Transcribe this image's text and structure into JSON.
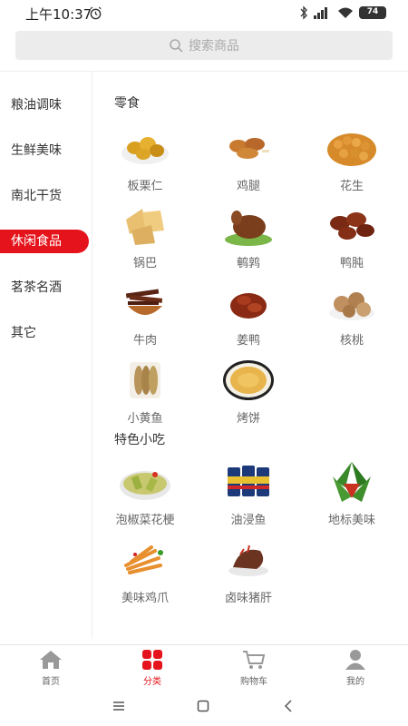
{
  "status_bar": {
    "time": "上午10:37",
    "battery": "74",
    "icons": [
      "alarm-icon",
      "bluetooth-icon",
      "signal-icon",
      "wifi-icon",
      "battery-icon"
    ]
  },
  "search": {
    "placeholder": "搜索商品",
    "icon": "search-icon"
  },
  "sidebar": {
    "items": [
      {
        "label": "粮油调味",
        "active": false
      },
      {
        "label": "生鲜美味",
        "active": false
      },
      {
        "label": "南北干货",
        "active": false
      },
      {
        "label": "休闲食品",
        "active": true
      },
      {
        "label": "茗茶名酒",
        "active": false
      },
      {
        "label": "其它",
        "active": false
      }
    ]
  },
  "sections": [
    {
      "title": "零食",
      "products": [
        {
          "name": "板栗仁",
          "icon": "chestnut-icon"
        },
        {
          "name": "鸡腿",
          "icon": "drumstick-icon"
        },
        {
          "name": "花生",
          "icon": "peanut-icon"
        },
        {
          "name": "锅巴",
          "icon": "rice-crisp-icon"
        },
        {
          "name": "鹌鹑",
          "icon": "quail-icon"
        },
        {
          "name": "鸭肫",
          "icon": "duck-gizzard-icon"
        },
        {
          "name": "牛肉",
          "icon": "beef-jerky-icon"
        },
        {
          "name": "姜鸭",
          "icon": "ginger-duck-icon"
        },
        {
          "name": "核桃",
          "icon": "walnut-icon"
        },
        {
          "name": "小黄鱼",
          "icon": "small-fish-icon"
        },
        {
          "name": "烤饼",
          "icon": "baked-cake-icon"
        }
      ]
    },
    {
      "title": "特色小吃",
      "products": [
        {
          "name": "泡椒菜花梗",
          "icon": "pickled-vegetable-icon"
        },
        {
          "name": "油浸鱼",
          "icon": "canned-fish-icon"
        },
        {
          "name": "地标美味",
          "icon": "zongzi-icon"
        },
        {
          "name": "美味鸡爪",
          "icon": "chicken-feet-icon"
        },
        {
          "name": "卤味猪肝",
          "icon": "pork-liver-icon"
        }
      ]
    }
  ],
  "bottom_nav": {
    "items": [
      {
        "label": "首页",
        "icon": "home-icon",
        "active": false
      },
      {
        "label": "分类",
        "icon": "category-icon",
        "active": true
      },
      {
        "label": "购物车",
        "icon": "cart-icon",
        "active": false
      },
      {
        "label": "我的",
        "icon": "user-icon",
        "active": false
      }
    ]
  },
  "colors": {
    "accent": "#e5141c",
    "search_bg": "#ececec",
    "nav_inactive": "#999999"
  },
  "system_nav": {
    "icons": [
      "menu-icon",
      "home-square-icon",
      "back-icon"
    ]
  }
}
